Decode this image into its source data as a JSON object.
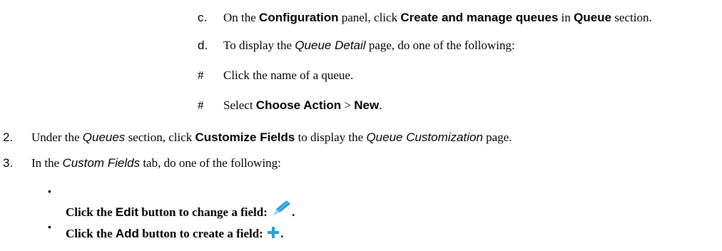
{
  "steps": {
    "c": {
      "marker": "c.",
      "t1": "On the ",
      "b1": "Configuration",
      "t2": " panel, click ",
      "b2": "Create and manage queues",
      "t3": " in ",
      "b3": "Queue",
      "t4": " section."
    },
    "d": {
      "marker": "d.",
      "t1": "To display the ",
      "i1": "Queue Detail",
      "t2": " page, do one of the following:"
    },
    "d1": {
      "marker": "#",
      "t1": "Click the name of a queue."
    },
    "d2": {
      "marker": "#",
      "t1": "Select ",
      "b1": "Choose Action",
      "t2": " > ",
      "b2": "New",
      "t3": "."
    },
    "s2": {
      "marker": "2.",
      "t1": "Under the ",
      "i1": "Queues",
      "t2": " section, click ",
      "b1": "Customize Fields",
      "t3": " to display the ",
      "i2": "Queue Customization",
      "t4": " page."
    },
    "s3": {
      "marker": "3.",
      "t1": "In the ",
      "i1": "Custom Fields",
      "t2": "  tab, do one of the following:"
    },
    "b1": {
      "marker": "•",
      "t1": "Click the ",
      "b1": "Edit",
      "t2": " button to change a field: ",
      "t3": ".",
      "icon": "pencil-icon"
    },
    "b2": {
      "marker": "•",
      "t1": "Click the ",
      "b1": "Add",
      "t2": " button to create a field: ",
      "t3": ".",
      "icon": "plus-icon"
    }
  },
  "colors": {
    "icon": "#2a9fd6"
  }
}
